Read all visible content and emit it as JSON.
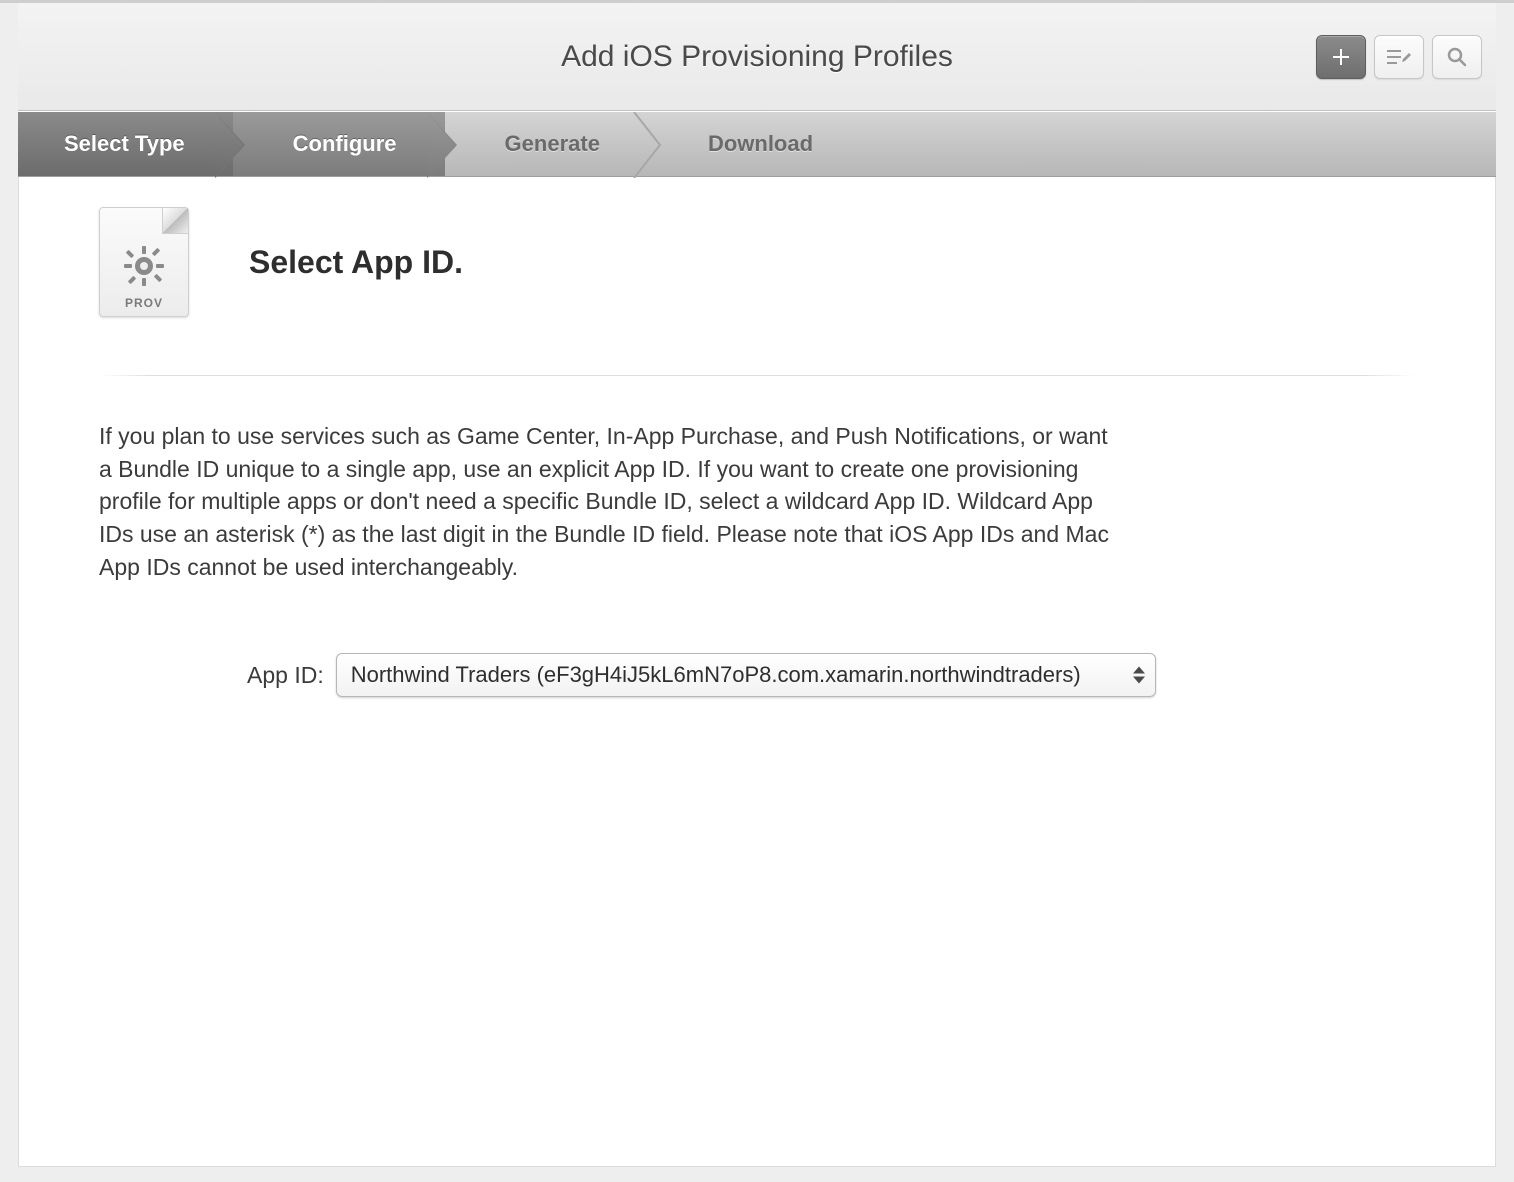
{
  "header": {
    "title": "Add iOS Provisioning Profiles"
  },
  "steps": [
    {
      "label": "Select Type",
      "active": true
    },
    {
      "label": "Configure",
      "active": true
    },
    {
      "label": "Generate",
      "active": false
    },
    {
      "label": "Download",
      "active": false
    }
  ],
  "section": {
    "icon_label": "PROV",
    "title": "Select App ID.",
    "description": "If you plan to use services such as Game Center, In-App Purchase, and Push Notifications, or want a Bundle ID unique to a single app, use an explicit App ID. If you want to create one provisioning profile for multiple apps or don't need a specific Bundle ID, select a wildcard App ID. Wildcard App IDs use an asterisk (*) as the last digit in the Bundle ID field. Please note that iOS App IDs and Mac App IDs cannot be used interchangeably."
  },
  "field": {
    "label": "App ID:",
    "selected": "Northwind Traders  (eF3gH4iJ5kL6mN7oP8.com.xamarin.northwindtraders)"
  },
  "icons": {
    "plus": "plus-icon",
    "edit": "edit-list-icon",
    "search": "search-icon",
    "gear": "gear-icon",
    "chevron_updown": "chevron-updown-icon"
  }
}
